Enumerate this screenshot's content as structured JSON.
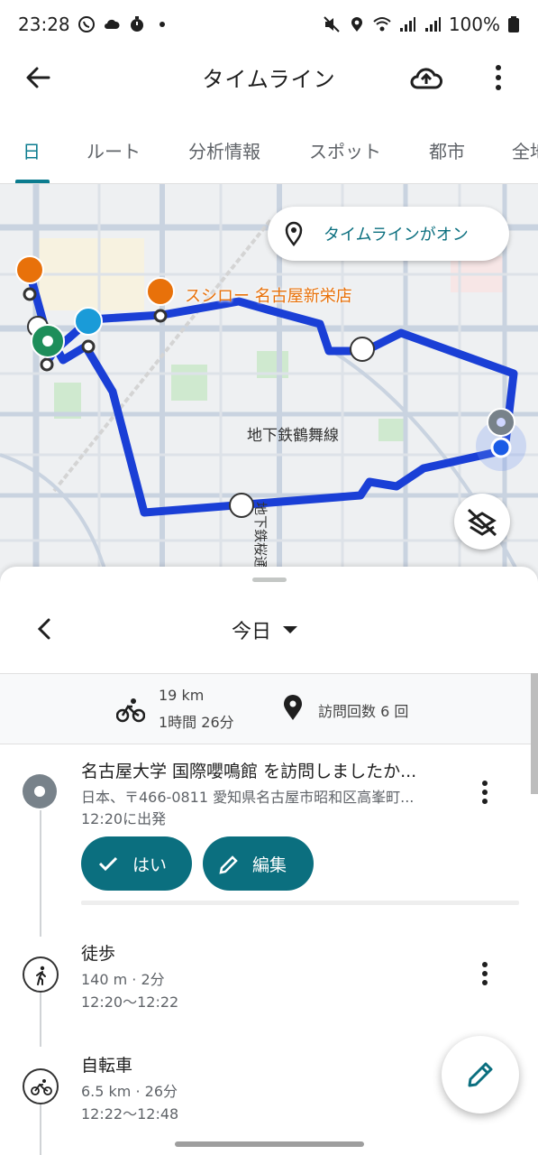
{
  "status_bar": {
    "time": "23:28",
    "battery": "100%",
    "icons_left": [
      "whatsapp-icon",
      "cloud-icon",
      "timer-icon",
      "dot-icon"
    ],
    "icons_right": [
      "mute-icon",
      "location-icon",
      "wifi-icon",
      "signal-icon",
      "signal-icon",
      "battery-icon"
    ]
  },
  "app_bar": {
    "title": "タイムライン",
    "back_icon": "arrow-back-icon",
    "backup_icon": "cloud-upload-icon",
    "menu_icon": "more-vert-icon"
  },
  "tabs": [
    {
      "label": "日",
      "active": true
    },
    {
      "label": "ルート",
      "active": false
    },
    {
      "label": "分析情報",
      "active": false
    },
    {
      "label": "スポット",
      "active": false
    },
    {
      "label": "都市",
      "active": false
    },
    {
      "label": "全地",
      "active": false
    }
  ],
  "map": {
    "timeline_chip": "タイムラインがオン",
    "place_label": "スシロー 名古屋新栄店",
    "line_label": "地下鉄鶴舞線",
    "line_label2": "地下鉄桜通",
    "route_color": "#1a3fd6",
    "place_color": "#e8710a"
  },
  "date_nav": {
    "label": "今日"
  },
  "summary": {
    "distance": "19 km",
    "duration": "1時間 26分",
    "visits": "訪問回数 6 回"
  },
  "entries": {
    "place": {
      "title": "名古屋大学 国際嚶鳴館 を訪問しましたか...",
      "address": "日本、〒466-0811 愛知県名古屋市昭和区高峯町...",
      "time": "12:20に出発",
      "yes_label": "はい",
      "edit_label": "編集"
    },
    "walk": {
      "title": "徒歩",
      "detail": "140 m · 2分",
      "time": "12:20〜12:22"
    },
    "bike": {
      "title": "自転車",
      "detail": "6.5 km · 26分",
      "time": "12:22〜12:48"
    }
  },
  "colors": {
    "accent": "#0b6f7f",
    "tab_active": "#0b7c8f"
  }
}
